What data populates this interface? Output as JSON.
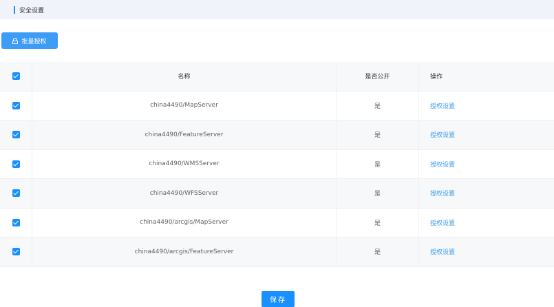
{
  "header": {
    "title": "安全设置"
  },
  "toolbar": {
    "batch_label": "批量授权"
  },
  "table": {
    "columns": {
      "name": "名称",
      "public": "是否公开",
      "ops": "操作"
    },
    "rows": [
      {
        "name": "china4490/MapServer",
        "public": "是",
        "action": "授权设置",
        "checked": true
      },
      {
        "name": "china4490/FeatureServer",
        "public": "是",
        "action": "授权设置",
        "checked": true
      },
      {
        "name": "china4490/WMSServer",
        "public": "是",
        "action": "授权设置",
        "checked": true
      },
      {
        "name": "china4490/WFSServer",
        "public": "是",
        "action": "授权设置",
        "checked": true
      },
      {
        "name": "china4490/arcgis/MapServer",
        "public": "是",
        "action": "授权设置",
        "checked": true
      },
      {
        "name": "china4490/arcgis/FeatureServer",
        "public": "是",
        "action": "授权设置",
        "checked": true
      }
    ]
  },
  "footer": {
    "save_label": "保存"
  },
  "colors": {
    "accent": "#1890ff",
    "button": "#3d9cf5",
    "header_bg": "#f0f3fa"
  },
  "icons": {
    "batch": "lock-icon",
    "check": "checkbox-checked-icon"
  }
}
